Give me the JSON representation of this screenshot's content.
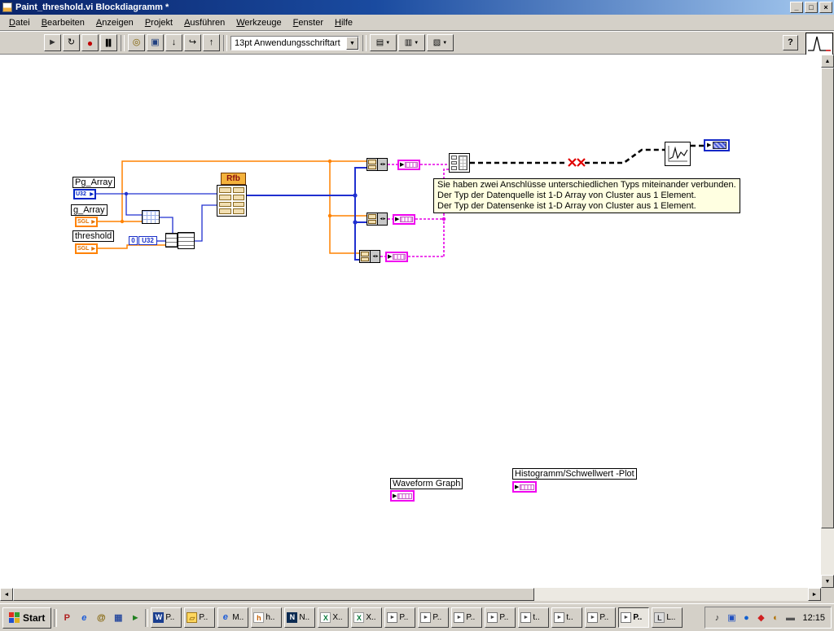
{
  "window": {
    "title": "Paint_threshold.vi Blockdiagramm *",
    "controls": {
      "minimize": "_",
      "maximize": "□",
      "close": "×"
    }
  },
  "menu": {
    "items": [
      {
        "label": "Datei"
      },
      {
        "label": "Bearbeiten"
      },
      {
        "label": "Anzeigen"
      },
      {
        "label": "Projekt"
      },
      {
        "label": "Ausführen"
      },
      {
        "label": "Werkzeuge"
      },
      {
        "label": "Fenster"
      },
      {
        "label": "Hilfe"
      }
    ]
  },
  "toolbar": {
    "font_selector": "13pt Anwendungsschriftart",
    "icons": {
      "run": "►",
      "run_continuous": "↻",
      "abort": "●",
      "pause": "▌▌",
      "highlight": "◎",
      "retain": "▣",
      "step_into": "↓",
      "step_over": "↪",
      "step_out": "↑",
      "dropdown": "▼",
      "align": "▤",
      "distribute": "▥",
      "reorder": "▧",
      "help": "?"
    }
  },
  "diagram": {
    "labels": {
      "pg_array": "Pg_Array",
      "g_array": "g_Array",
      "threshold": "threshold",
      "waveform_graph": "Waveform Graph",
      "histogram": "Histogramm/Schwellwert -Plot"
    },
    "terminals": {
      "pg_array_type": "U32",
      "g_array_type": "SGL",
      "threshold_type": "SGL"
    },
    "constants": {
      "zero": "0",
      "u32": "U32"
    },
    "rfb": "Rfb",
    "icons": {
      "arrow": "▶",
      "bundle": "◄►"
    },
    "error_tip": {
      "lines": [
        "Sie haben zwei Anschlüsse unterschiedlichen Typs miteinander verbunden.",
        "Der Typ der Datenquelle ist 1-D Array von Cluster aus 1 Element.",
        "Der Typ der Datensenke ist 1-D Array von Cluster aus 1 Element."
      ]
    }
  },
  "scrollbar_icons": {
    "up": "▲",
    "down": "▼",
    "left": "◄",
    "right": "►"
  },
  "taskbar": {
    "start_label": "Start",
    "clock": "12:15",
    "quick_launch": [
      {
        "name": "paint",
        "glyph": "P"
      },
      {
        "name": "internet-explorer",
        "glyph": "e"
      },
      {
        "name": "mail",
        "glyph": "@"
      },
      {
        "name": "show-desktop",
        "glyph": "▦"
      },
      {
        "name": "media-player",
        "glyph": "►"
      }
    ],
    "buttons": [
      {
        "label": "P..",
        "glyph": "W",
        "kind": "word"
      },
      {
        "label": "P..",
        "glyph": "▱",
        "kind": "folder"
      },
      {
        "label": "M..",
        "glyph": "e",
        "kind": "ie"
      },
      {
        "label": "h..",
        "glyph": "h",
        "kind": "html"
      },
      {
        "label": "N..",
        "glyph": "N",
        "kind": "netscape"
      },
      {
        "label": "X..",
        "glyph": "X",
        "kind": "excel"
      },
      {
        "label": "X..",
        "glyph": "X",
        "kind": "excel"
      },
      {
        "label": "P..",
        "glyph": "►",
        "kind": "labview"
      },
      {
        "label": "P..",
        "glyph": "►",
        "kind": "labview"
      },
      {
        "label": "P..",
        "glyph": "►",
        "kind": "labview"
      },
      {
        "label": "P..",
        "glyph": "►",
        "kind": "labview"
      },
      {
        "label": "t..",
        "glyph": "►",
        "kind": "labview"
      },
      {
        "label": "t..",
        "glyph": "►",
        "kind": "labview"
      },
      {
        "label": "P..",
        "glyph": "►",
        "kind": "labview"
      },
      {
        "label": "P..",
        "glyph": "►",
        "kind": "labview"
      },
      {
        "label": "L..",
        "glyph": "L",
        "kind": "doc"
      }
    ],
    "tray": [
      {
        "name": "volume",
        "glyph": "♪"
      },
      {
        "name": "display",
        "glyph": "▣"
      },
      {
        "name": "network",
        "glyph": "●"
      },
      {
        "name": "antivirus",
        "glyph": "◆"
      },
      {
        "name": "updates",
        "glyph": "◐"
      },
      {
        "name": "input-language",
        "glyph": "▬"
      }
    ]
  }
}
